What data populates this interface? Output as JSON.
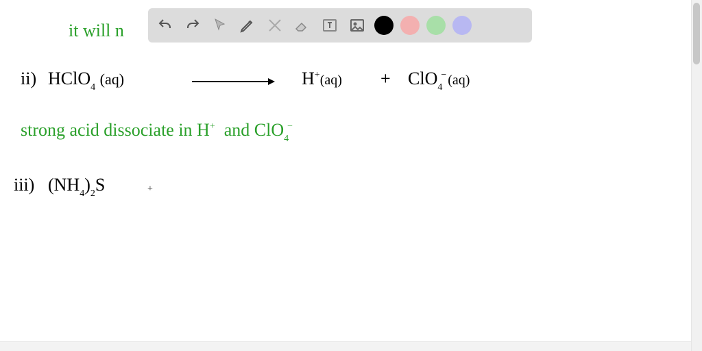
{
  "toolbar": {
    "tools": [
      {
        "name": "undo-icon"
      },
      {
        "name": "redo-icon"
      },
      {
        "name": "pointer-icon"
      },
      {
        "name": "pencil-icon"
      },
      {
        "name": "tools-crossed-icon"
      },
      {
        "name": "eraser-icon"
      },
      {
        "name": "text-box-icon"
      },
      {
        "name": "image-icon"
      }
    ],
    "swatches": [
      {
        "name": "swatch-black",
        "color": "#000000"
      },
      {
        "name": "swatch-red",
        "color": "#f3b0b0"
      },
      {
        "name": "swatch-green",
        "color": "#a8dfa8"
      },
      {
        "name": "swatch-purple",
        "color": "#b8b8f2"
      }
    ]
  },
  "lines": {
    "l1": "it will n",
    "eq_ii_label": "ii)",
    "eq_ii_lhs": "HClO",
    "eq_ii_lhs_sub": "4",
    "eq_ii_lhs_state": "(aq)",
    "eq_ii_rhs_h": "H",
    "eq_ii_rhs_h_sup": "+",
    "eq_ii_rhs_h_state": "(aq)",
    "eq_ii_plus": "+",
    "eq_ii_rhs_cl": "ClO",
    "eq_ii_rhs_cl_sub": "4",
    "eq_ii_rhs_cl_sup": "−",
    "eq_ii_rhs_cl_state": "(aq)",
    "l3a": "strong acid  dissociate  in  H",
    "l3a_sup": "+",
    "l3b": "and  ClO",
    "l3b_sub": "4",
    "l3b_sup": "−",
    "eq_iii_label": "iii)",
    "eq_iii": "(NH",
    "eq_iii_sub1": "4",
    "eq_iii_close": ")",
    "eq_iii_sub2": "2",
    "eq_iii_tail": "S",
    "cursor": "+"
  }
}
